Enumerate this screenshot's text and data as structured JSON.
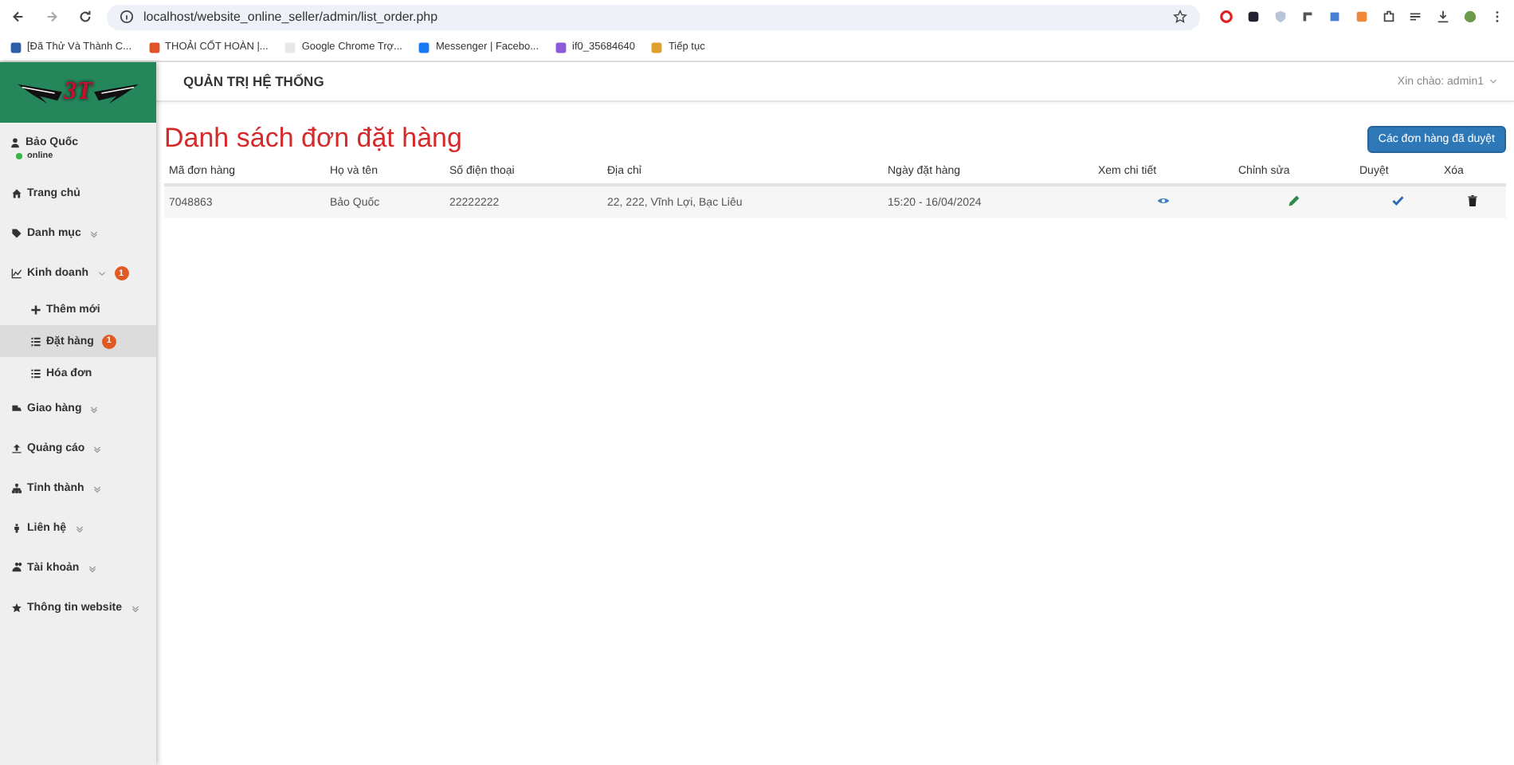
{
  "browser": {
    "url": "localhost/website_online_seller/admin/list_order.php",
    "bookmarks": [
      {
        "label": "[Đã Thử Và Thành C..."
      },
      {
        "label": "THOẢI CỐT HOÀN |..."
      },
      {
        "label": "Google Chrome Trợ..."
      },
      {
        "label": "Messenger | Facebo..."
      },
      {
        "label": "if0_35684640"
      },
      {
        "label": "Tiếp tục"
      }
    ]
  },
  "sidebar": {
    "logo_text": "3T",
    "user": {
      "name": "Bảo Quốc",
      "status": "online"
    },
    "items": [
      {
        "label": "Trang chủ",
        "selected": false
      },
      {
        "label": "Danh mục",
        "selected": false,
        "expanded": false
      },
      {
        "label": "Kinh doanh",
        "selected": false,
        "expanded": true,
        "badge": "1",
        "children": [
          {
            "label": "Thêm mới",
            "selected": false
          },
          {
            "label": "Đặt hàng",
            "selected": true,
            "badge": "1"
          },
          {
            "label": "Hóa đơn",
            "selected": false
          }
        ]
      },
      {
        "label": "Giao hàng",
        "selected": false,
        "expanded": false
      },
      {
        "label": "Quảng cáo",
        "selected": false,
        "expanded": false
      },
      {
        "label": "Tỉnh thành",
        "selected": false,
        "expanded": false
      },
      {
        "label": "Liên hệ",
        "selected": false,
        "expanded": false
      },
      {
        "label": "Tài khoản",
        "selected": false,
        "expanded": false
      },
      {
        "label": "Thông tin website",
        "selected": false,
        "expanded": false
      }
    ]
  },
  "header": {
    "title": "QUẢN TRỊ HỆ THỐNG",
    "greeting": "Xin chào: admin1"
  },
  "page": {
    "title": "Danh sách đơn đặt hàng",
    "button": "Các đơn hàng đã duyệt"
  },
  "table": {
    "columns": [
      "Mã đơn hàng",
      "Họ và tên",
      "Số điện thoại",
      "Địa chỉ",
      "Ngày đặt hàng",
      "Xem chi tiết",
      "Chỉnh sửa",
      "Duyệt",
      "Xóa"
    ],
    "rows": [
      {
        "cells": [
          "7048863",
          "Bảo Quốc",
          "22222222",
          "22, 222, Vĩnh Lợi, Bạc Liêu",
          "15:20 - 16/04/2024"
        ]
      }
    ]
  }
}
